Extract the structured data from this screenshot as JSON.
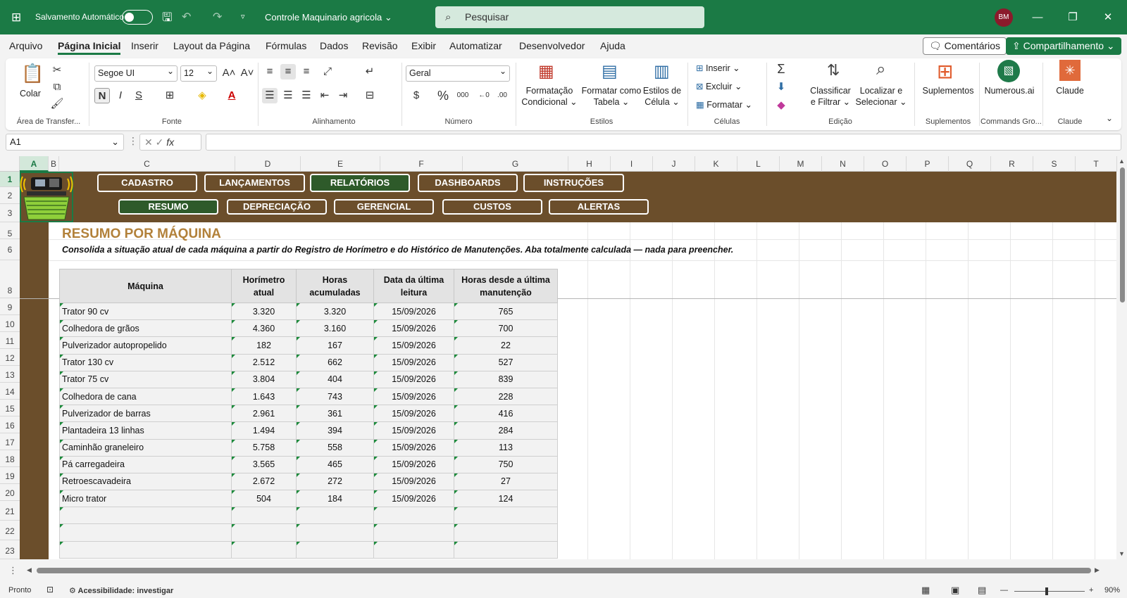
{
  "titlebar": {
    "autosave_label": "Salvamento Automático",
    "doc_title": "Controle Maquinario agricola",
    "search_placeholder": "Pesquisar",
    "user_initials": "BM"
  },
  "menu": {
    "tabs": [
      "Arquivo",
      "Página Inicial",
      "Inserir",
      "Layout da Página",
      "Fórmulas",
      "Dados",
      "Revisão",
      "Exibir",
      "Automatizar",
      "Desenvolvedor",
      "Ajuda"
    ],
    "active_tab": "Página Inicial",
    "comments": "Comentários",
    "share": "Compartilhamento"
  },
  "ribbon": {
    "paste": "Colar",
    "clipboard_group": "Área de Transfer...",
    "font_name": "Segoe UI",
    "font_size": "12",
    "font_group": "Fonte",
    "bold": "N",
    "italic": "I",
    "underline": "S",
    "align_group": "Alinhamento",
    "number_format": "Geral",
    "number_group": "Número",
    "cond_format": [
      "Formatação",
      "Condicional ⌄"
    ],
    "format_table": [
      "Formatar como",
      "Tabela ⌄"
    ],
    "cell_styles": [
      "Estilos de",
      "Célula ⌄"
    ],
    "styles_group": "Estilos",
    "insert": "Inserir ⌄",
    "delete": "Excluir ⌄",
    "format": "Formatar ⌄",
    "cells_group": "Células",
    "sort_filter": [
      "Classificar",
      "e Filtrar ⌄"
    ],
    "find_select": [
      "Localizar e",
      "Selecionar ⌄"
    ],
    "edit_group": "Edição",
    "addins": "Suplementos",
    "addins_group": "Suplementos",
    "numerous": "Numerous.ai",
    "numerous_group": "Commands Gro...",
    "claude": "Claude",
    "claude_group": "Claude"
  },
  "formula_bar": {
    "name_box": "A1",
    "fx": "fx",
    "content": ""
  },
  "columns": [
    "A",
    "B",
    "C",
    "D",
    "E",
    "F",
    "G",
    "H",
    "I",
    "J",
    "K",
    "L",
    "M",
    "N",
    "O",
    "P",
    "Q",
    "R",
    "S",
    "T"
  ],
  "rows": [
    "1",
    "2",
    "3",
    "5",
    "6",
    "8",
    "9",
    "10",
    "11",
    "12",
    "13",
    "14",
    "15",
    "16",
    "17",
    "18",
    "19",
    "20",
    "21",
    "22",
    "23"
  ],
  "sheet": {
    "nav_top": [
      "CADASTRO",
      "LANÇAMENTOS",
      "RELATÓRIOS",
      "DASHBOARDS",
      "INSTRUÇÕES"
    ],
    "nav_sub": [
      "RESUMO",
      "DEPRECIAÇÃO",
      "GERENCIAL",
      "CUSTOS",
      "ALERTAS"
    ],
    "title": "RESUMO POR MÁQUINA",
    "subtitle": "Consolida a situação atual de cada máquina a partir do Registro de Horímetro e do Histórico de Manutenções. Aba totalmente calculada — nada para preencher.",
    "headers": [
      "Máquina",
      "Horímetro atual",
      "Horas acumuladas",
      "Data da última leitura",
      "Horas desde a última manutenção"
    ],
    "rows": [
      [
        "Trator 90 cv",
        "3.320",
        "3.320",
        "15/09/2026",
        "765"
      ],
      [
        "Colhedora de grãos",
        "4.360",
        "3.160",
        "15/09/2026",
        "700"
      ],
      [
        "Pulverizador autopropelido",
        "182",
        "167",
        "15/09/2026",
        "22"
      ],
      [
        "Trator 130 cv",
        "2.512",
        "662",
        "15/09/2026",
        "527"
      ],
      [
        "Trator 75 cv",
        "3.804",
        "404",
        "15/09/2026",
        "839"
      ],
      [
        "Colhedora de cana",
        "1.643",
        "743",
        "15/09/2026",
        "228"
      ],
      [
        "Pulverizador de barras",
        "2.961",
        "361",
        "15/09/2026",
        "416"
      ],
      [
        "Plantadeira 13 linhas",
        "1.494",
        "394",
        "15/09/2026",
        "284"
      ],
      [
        "Caminhão graneleiro",
        "5.758",
        "558",
        "15/09/2026",
        "113"
      ],
      [
        "Pá carregadeira",
        "3.565",
        "465",
        "15/09/2026",
        "750"
      ],
      [
        "Retroescavadeira",
        "2.672",
        "272",
        "15/09/2026",
        "27"
      ],
      [
        "Micro trator",
        "504",
        "184",
        "15/09/2026",
        "124"
      ],
      [
        "",
        "",
        "",
        "",
        ""
      ],
      [
        "",
        "",
        "",
        "",
        ""
      ],
      [
        "",
        "",
        "",
        "",
        ""
      ]
    ]
  },
  "status": {
    "ready": "Pronto",
    "accessibility": "Acessibilidade: investigar",
    "zoom": "90%"
  },
  "colors": {
    "excel_green": "#1b7a45",
    "banner_brown": "#6b4e2b",
    "nav_active": "#2e5a2a",
    "title_gold": "#b2813a"
  }
}
